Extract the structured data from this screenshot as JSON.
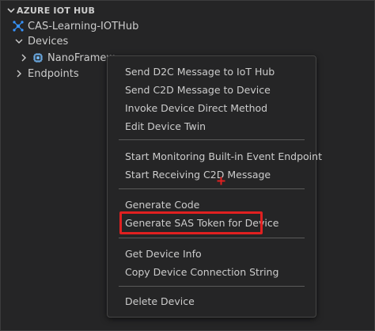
{
  "explorer": {
    "section_title": "AZURE IOT HUB",
    "hub_name": "CAS-Learning-IOTHub",
    "devices_label": "Devices",
    "device_name": "NanoFramew",
    "endpoints_label": "Endpoints"
  },
  "context_menu": {
    "groups": [
      [
        "Send D2C Message to IoT Hub",
        "Send C2D Message to Device",
        "Invoke Device Direct Method",
        "Edit Device Twin"
      ],
      [
        "Start Monitoring Built-in Event Endpoint",
        "Start Receiving C2D Message"
      ],
      [
        "Generate Code",
        "Generate SAS Token for Device"
      ],
      [
        "Get Device Info",
        "Copy Device Connection String"
      ],
      [
        "Delete Device"
      ]
    ],
    "highlighted_item": "Generate SAS Token for Device"
  },
  "colors": {
    "background": "#252526",
    "text": "#cccccc",
    "highlight_border": "#e02020",
    "hub_icon": "#3794ff",
    "device_icon": "#75beff"
  },
  "icons": {
    "section_chevron": "chevron-down-icon",
    "hub": "iot-hub-icon",
    "device": "chip-icon",
    "cursor": "plus-cursor-icon"
  }
}
